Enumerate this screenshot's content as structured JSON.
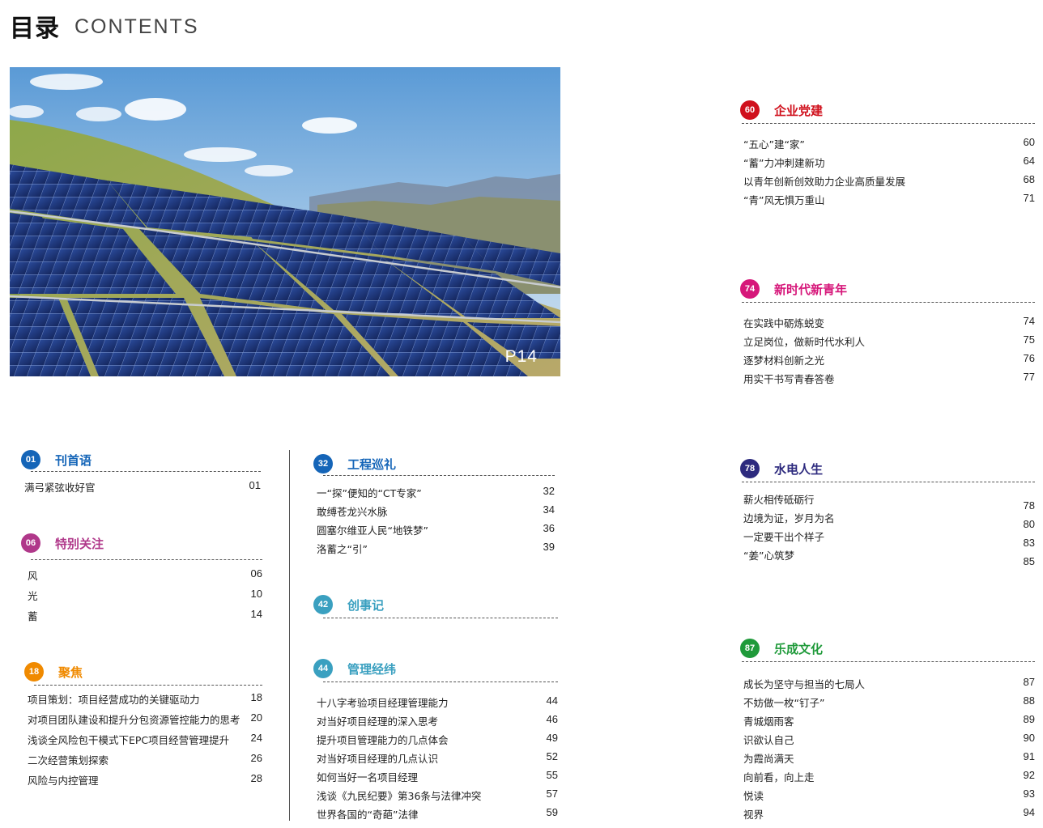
{
  "header": {
    "title_zh": "目录",
    "title_en": "CONTENTS"
  },
  "photo": {
    "label": "P14"
  },
  "sections": [
    {
      "num": "01",
      "title": "刊首语",
      "color": "#1565b8",
      "items": [
        {
          "t": "满弓紧弦收好官",
          "p": "01"
        }
      ]
    },
    {
      "num": "06",
      "title": "特别关注",
      "color": "#b0388a",
      "items": [
        {
          "t": "风",
          "p": "06"
        },
        {
          "t": "光",
          "p": "10"
        },
        {
          "t": "蓄",
          "p": "14"
        }
      ]
    },
    {
      "num": "18",
      "title": "聚焦",
      "color": "#f08a00",
      "items": [
        {
          "t": "项目策划：项目经营成功的关键驱动力",
          "p": "18"
        },
        {
          "t": "对项目团队建设和提升分包资源管控能力的思考",
          "p": "20"
        },
        {
          "t": "浅谈全风险包干模式下EPC项目经营管理提升",
          "p": "24"
        },
        {
          "t": "二次经营策划探索",
          "p": "26"
        },
        {
          "t": "风险与内控管理",
          "p": "28"
        }
      ]
    },
    {
      "num": "32",
      "title": "工程巡礼",
      "color": "#1565b8",
      "items": [
        {
          "t": "一“探”便知的“CT专家”",
          "p": "32"
        },
        {
          "t": "敢缚苍龙兴水脉",
          "p": "34"
        },
        {
          "t": "圆塞尔维亚人民“地铁梦”",
          "p": "36"
        },
        {
          "t": "洛蓄之“引”",
          "p": "39"
        }
      ]
    },
    {
      "num": "42",
      "title": "创事记",
      "color": "#3aa0c0",
      "items": []
    },
    {
      "num": "44",
      "title": "管理经纬",
      "color": "#3aa0c0",
      "items": [
        {
          "t": "十八字考验项目经理管理能力",
          "p": "44"
        },
        {
          "t": "对当好项目经理的深入思考",
          "p": "46"
        },
        {
          "t": "提升项目管理能力的几点体会",
          "p": "49"
        },
        {
          "t": "对当好项目经理的几点认识",
          "p": "52"
        },
        {
          "t": "如何当好一名项目经理",
          "p": "55"
        },
        {
          "t": "浅谈《九民纪要》第36条与法律冲突",
          "p": "57"
        },
        {
          "t": "世界各国的“奇葩”法律",
          "p": "59"
        }
      ]
    },
    {
      "num": "60",
      "title": "企业党建",
      "color": "#d0101c",
      "items": [
        {
          "t": "“五心”建“家”",
          "p": "60"
        },
        {
          "t": "“蓄”力冲刺建新功",
          "p": "64"
        },
        {
          "t": "以青年创新创效助力企业高质量发展",
          "p": "68"
        },
        {
          "t": "“青”风无惧万重山",
          "p": "71"
        }
      ]
    },
    {
      "num": "74",
      "title": "新时代新青年",
      "color": "#d6177a",
      "items": [
        {
          "t": "在实践中砺炼蜕变",
          "p": "74"
        },
        {
          "t": "立足岗位，做新时代水利人",
          "p": "75"
        },
        {
          "t": "逐梦材料创新之光",
          "p": "76"
        },
        {
          "t": "用实干书写青春答卷",
          "p": "77"
        }
      ]
    },
    {
      "num": "78",
      "title": "水电人生",
      "color": "#2d2a7e",
      "items": [
        {
          "t": "薪火相传砥砺行",
          "p": "78"
        },
        {
          "t": "边境为证，岁月为名",
          "p": "80"
        },
        {
          "t": "一定要干出个样子",
          "p": "83"
        },
        {
          "t": "“姜”心筑梦",
          "p": "85"
        }
      ]
    },
    {
      "num": "87",
      "title": "乐成文化",
      "color": "#1f9a3a",
      "items": [
        {
          "t": "成长为坚守与担当的七局人",
          "p": "87"
        },
        {
          "t": "不妨做一枚“钉子”",
          "p": "88"
        },
        {
          "t": "青城烟雨客",
          "p": "89"
        },
        {
          "t": "识欲认自己",
          "p": "90"
        },
        {
          "t": "为霞尚满天",
          "p": "91"
        },
        {
          "t": "向前看，向上走",
          "p": "92"
        },
        {
          "t": "悦读",
          "p": "93"
        },
        {
          "t": "视界",
          "p": "94"
        }
      ]
    }
  ]
}
